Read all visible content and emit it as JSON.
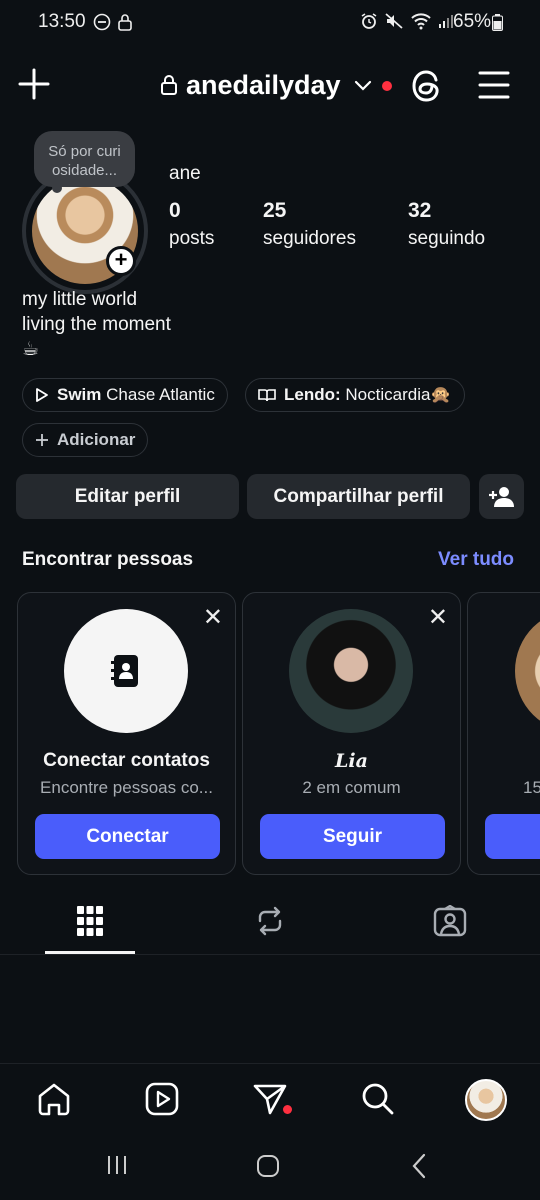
{
  "status_bar": {
    "time": "13:50",
    "battery": "65%"
  },
  "header": {
    "username": "anedailyday",
    "notification_color": "#ff3040"
  },
  "profile": {
    "note": "Só por curi osidade...",
    "name": "ane",
    "stats": [
      {
        "value": "0",
        "label": "posts"
      },
      {
        "value": "25",
        "label": "seguidores"
      },
      {
        "value": "32",
        "label": "seguindo"
      }
    ],
    "bio_line1": "my little world",
    "bio_line2": "living the moment",
    "bio_emoji": "☕",
    "music_pill": {
      "bold": "Swim",
      "text": "Chase Atlantic"
    },
    "reading_pill": {
      "bold": "Lendo:",
      "text": "Nocticardia🙊"
    },
    "add_pill": "Adicionar"
  },
  "actions": {
    "edit": "Editar perfil",
    "share": "Compartilhar perfil"
  },
  "discover": {
    "title": "Encontrar pessoas",
    "see_all": "Ver tudo",
    "cards": [
      {
        "title": "Conectar contatos",
        "subtitle": "Encontre pessoas co...",
        "button": "Conectar"
      },
      {
        "title": "Lia",
        "subtitle": "2 em comum",
        "button": "Seguir"
      },
      {
        "title": "",
        "subtitle": "15",
        "button": ""
      }
    ]
  },
  "colors": {
    "accent": "#4a5dfb",
    "link": "#7c8cff",
    "background": "#0c1014"
  }
}
